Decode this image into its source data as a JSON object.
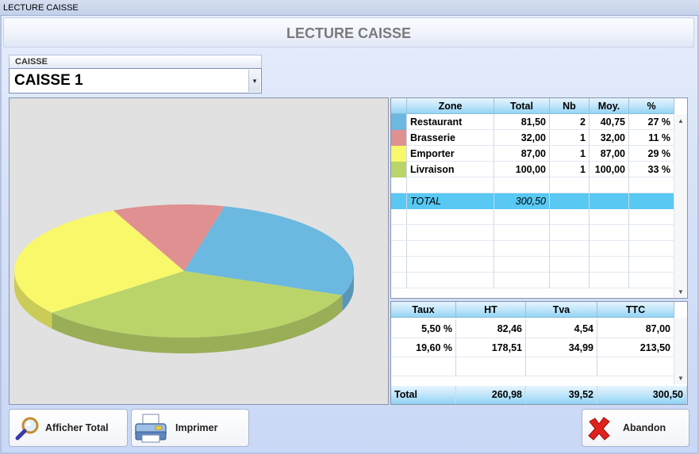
{
  "window": {
    "title": "LECTURE CAISSE"
  },
  "header": {
    "title": "LECTURE CAISSE"
  },
  "caisse": {
    "label": "CAISSE",
    "selected": "CAISSE 1",
    "arrow": "▾"
  },
  "zones": {
    "columns": [
      "Zone",
      "Total",
      "Nb",
      "Moy.",
      "%"
    ],
    "rows": [
      {
        "zone": "Restaurant",
        "total": "81,50",
        "nb": "2",
        "moy": "40,75",
        "pct": "27 %",
        "color": "#6bb8e0"
      },
      {
        "zone": "Brasserie",
        "total": "32,00",
        "nb": "1",
        "moy": "32,00",
        "pct": "11 %",
        "color": "#e09090"
      },
      {
        "zone": "Emporter",
        "total": "87,00",
        "nb": "1",
        "moy": "87,00",
        "pct": "29 %",
        "color": "#f8f86a"
      },
      {
        "zone": "Livraison",
        "total": "100,00",
        "nb": "1",
        "moy": "100,00",
        "pct": "33 %",
        "color": "#bad46a"
      }
    ],
    "total_label": "TOTAL",
    "total_value": "300,50"
  },
  "taxes": {
    "columns": [
      "Taux",
      "HT",
      "Tva",
      "TTC"
    ],
    "rows": [
      {
        "taux": "5,50 %",
        "ht": "82,46",
        "tva": "4,54",
        "ttc": "87,00"
      },
      {
        "taux": "19,60 %",
        "ht": "178,51",
        "tva": "34,99",
        "ttc": "213,50"
      }
    ],
    "total": {
      "label": "Total",
      "ht": "260,98",
      "tva": "39,52",
      "ttc": "300,50"
    }
  },
  "buttons": {
    "afficher_total": "Afficher Total",
    "imprimer": "Imprimer",
    "abandon": "Abandon"
  },
  "icons": {
    "afficher_total": "magnifier-icon",
    "imprimer": "printer-icon",
    "abandon": "red-x-icon"
  },
  "chart_data": {
    "type": "pie",
    "categories": [
      "Restaurant",
      "Brasserie",
      "Emporter",
      "Livraison"
    ],
    "values": [
      81.5,
      32.0,
      87.0,
      100.0
    ],
    "colors": [
      "#6bb8e0",
      "#e09090",
      "#f8f86a",
      "#bad46a"
    ],
    "style": "3d"
  }
}
